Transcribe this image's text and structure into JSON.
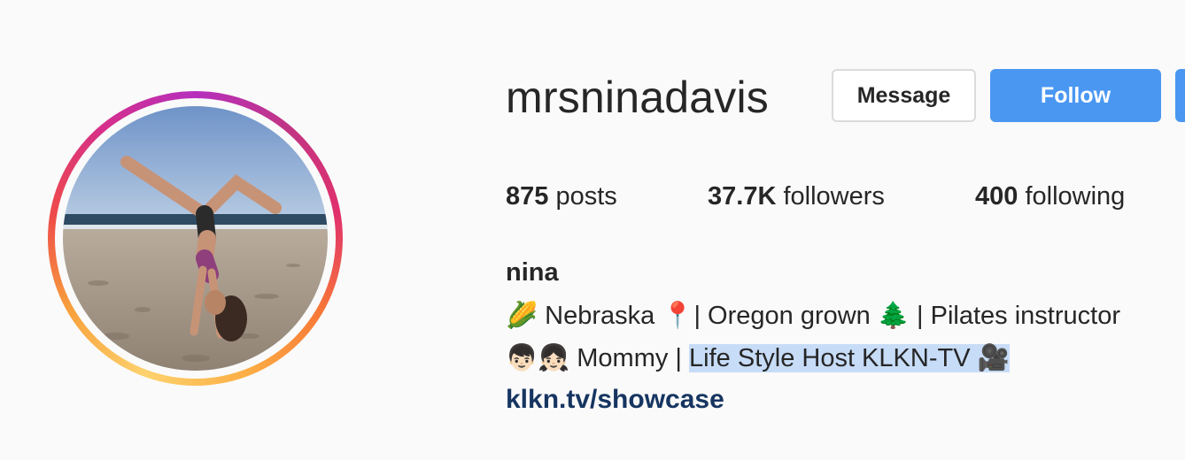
{
  "profile": {
    "username": "mrsninadavis",
    "full_name": "nina",
    "avatar_alt": "profile-photo-handstand-beach"
  },
  "actions": {
    "message_label": "Message",
    "follow_label": "Follow"
  },
  "stats": {
    "posts_count": "875",
    "posts_label": " posts",
    "followers_count": "37.7K",
    "followers_label": " followers",
    "following_count": "400",
    "following_label": " following"
  },
  "bio": {
    "line1": "🌽 Nebraska 📍| Oregon grown 🌲 | Pilates instructor",
    "line2_plain": "👦🏻👧🏻 Mommy | ",
    "line2_highlight": "Life Style Host KLKN-TV 🎥",
    "link": "klkn.tv/showcase"
  },
  "colors": {
    "follow_blue": "#4a97f2",
    "link_navy": "#163561",
    "selection_highlight": "#c7dcf7",
    "background": "#fafafa"
  }
}
